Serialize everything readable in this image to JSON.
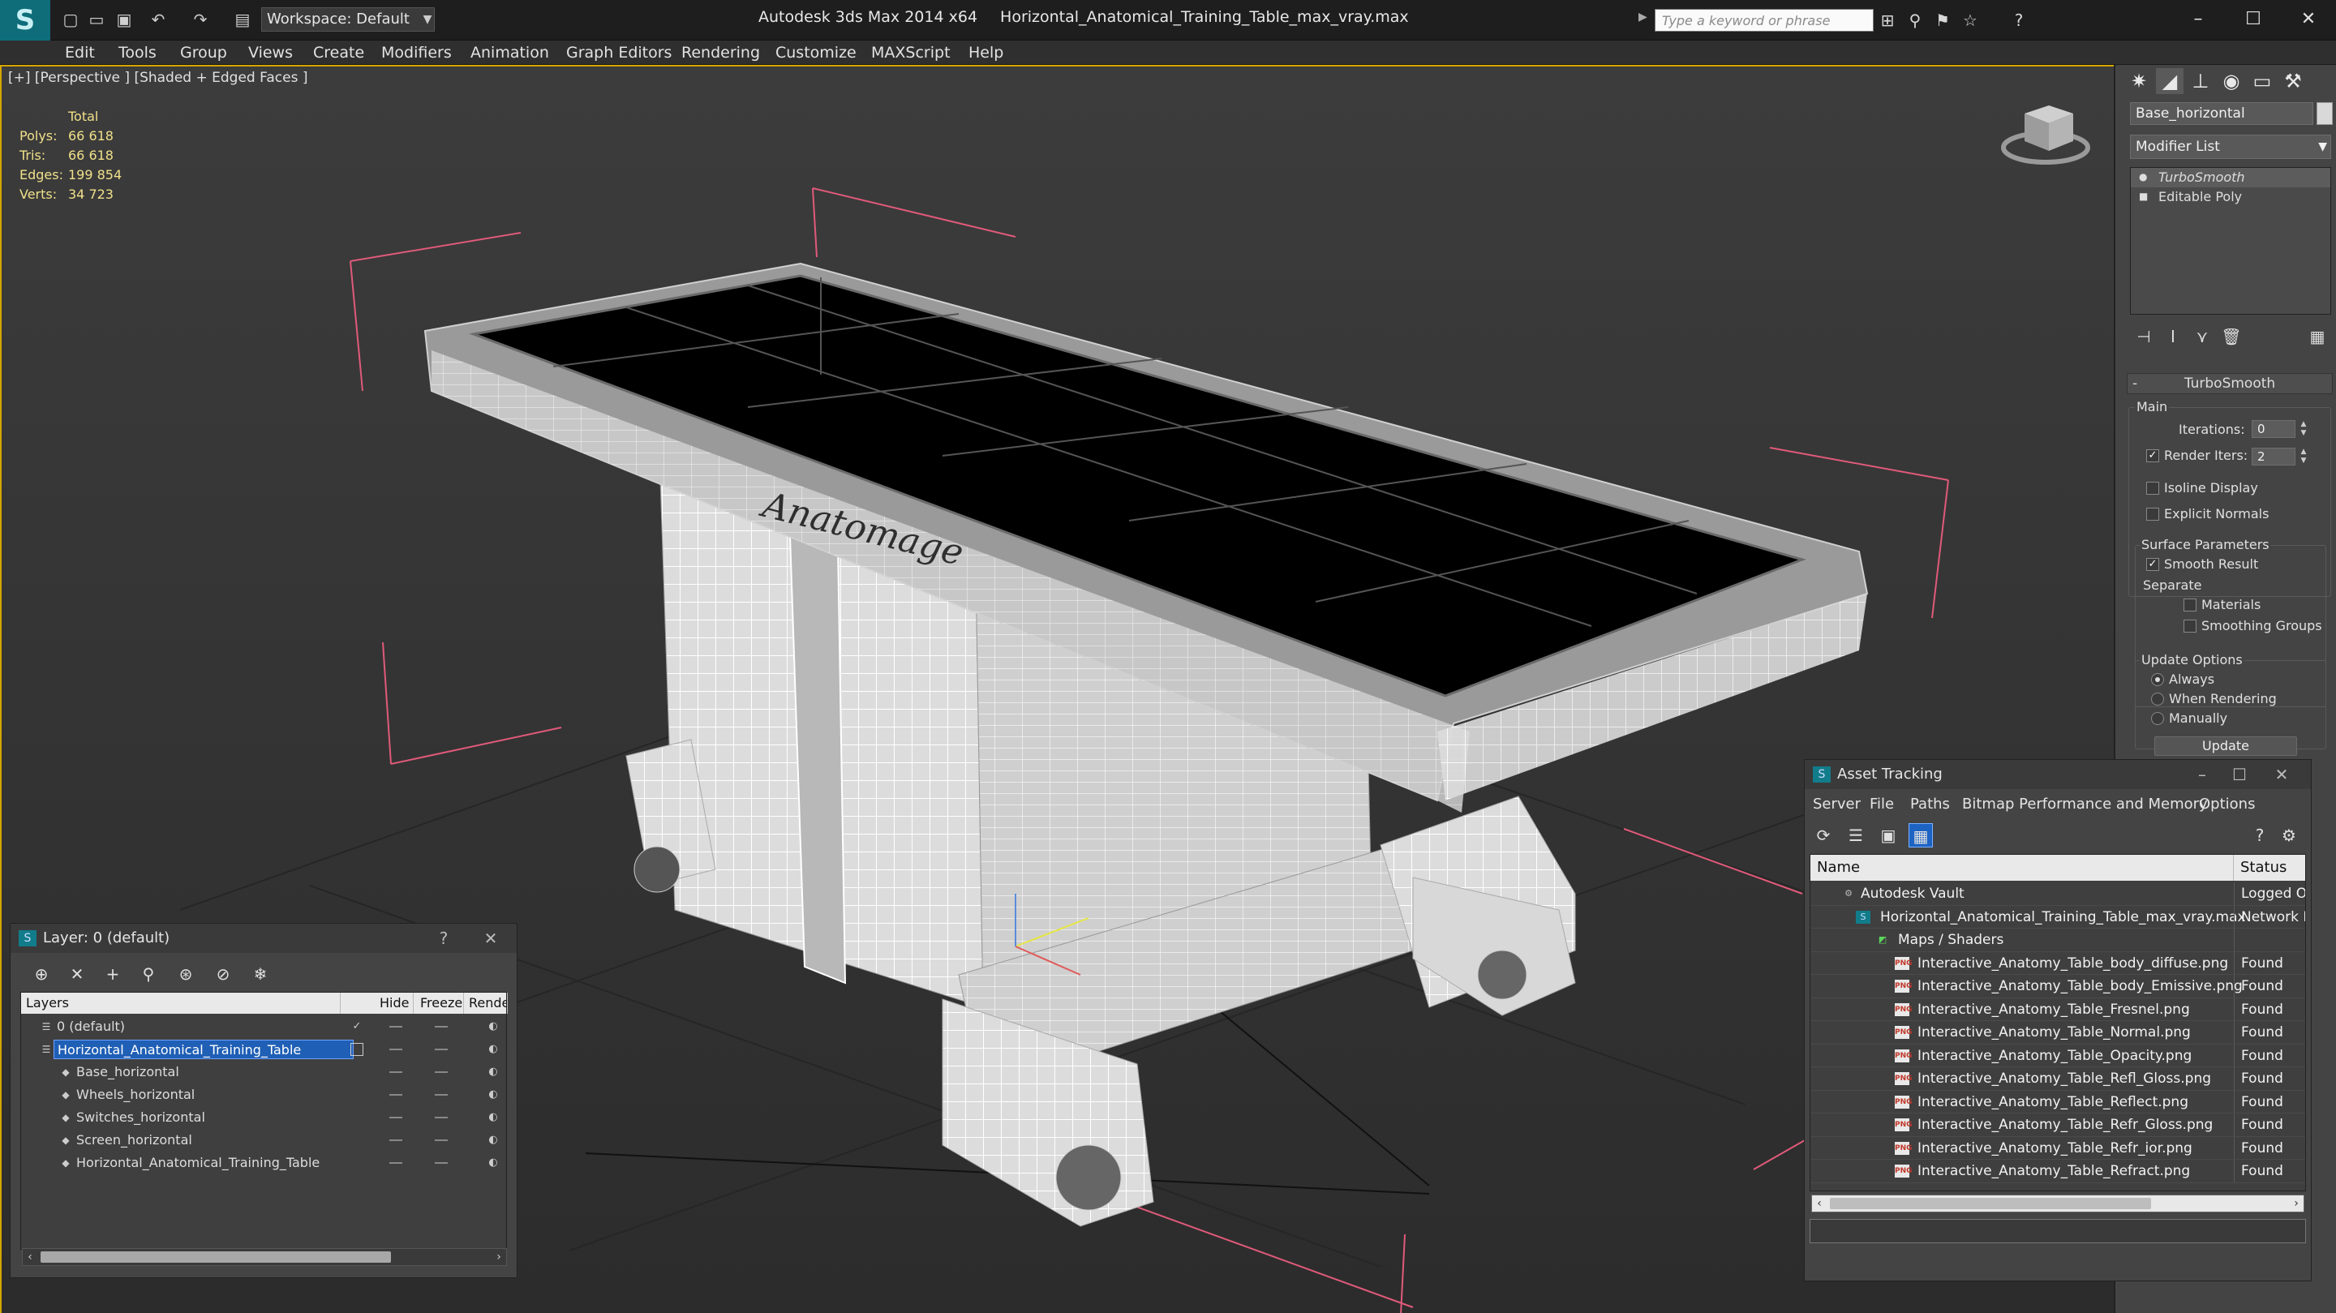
{
  "window": {
    "app_title": "Autodesk 3ds Max  2014 x64",
    "file_title": "Horizontal_Anatomical_Training_Table_max_vray.max",
    "workspace_label": "Workspace: Default",
    "search_placeholder": "Type a keyword or phrase"
  },
  "menu": [
    "Edit",
    "Tools",
    "Group",
    "Views",
    "Create",
    "Modifiers",
    "Animation",
    "Graph Editors",
    "Rendering",
    "Customize",
    "MAXScript",
    "Help"
  ],
  "viewport": {
    "label": "[+] [Perspective ] [Shaded + Edged Faces ]",
    "stats_header": "Total",
    "stats": [
      {
        "label": "Polys:",
        "value": "66 618"
      },
      {
        "label": "Tris:",
        "value": "66 618"
      },
      {
        "label": "Edges:",
        "value": "199 854"
      },
      {
        "label": "Verts:",
        "value": "34 723"
      }
    ],
    "model_brand_text": "Anatomage"
  },
  "command_panel": {
    "object_name": "Base_horizontal",
    "modifier_list_label": "Modifier List",
    "stack": [
      {
        "label": "TurboSmooth",
        "selected": true
      },
      {
        "label": "Editable Poly",
        "selected": false
      }
    ],
    "rollout_title": "TurboSmooth",
    "main_group": "Main",
    "iterations_label": "Iterations:",
    "iterations_value": "0",
    "render_iters_label": "Render Iters:",
    "render_iters_value": "2",
    "render_iters_checked": true,
    "isoline_label": "Isoline Display",
    "explicit_normals_label": "Explicit Normals",
    "surface_group": "Surface Parameters",
    "smooth_result_label": "Smooth Result",
    "separate_label": "Separate",
    "materials_label": "Materials",
    "smoothing_groups_label": "Smoothing Groups",
    "update_group": "Update Options",
    "always_label": "Always",
    "when_rendering_label": "When Rendering",
    "manually_label": "Manually",
    "update_button": "Update"
  },
  "layer_dialog": {
    "title": "Layer: 0 (default)",
    "help": "?",
    "columns": [
      "Layers",
      "Hide",
      "Freeze",
      "Rende"
    ],
    "rows": [
      {
        "name": "0 (default)",
        "level": 0
      },
      {
        "name": "Horizontal_Anatomical_Training_Table",
        "level": 0,
        "selected": true
      },
      {
        "name": "Base_horizontal",
        "level": 1
      },
      {
        "name": "Wheels_horizontal",
        "level": 1
      },
      {
        "name": "Switches_horizontal",
        "level": 1
      },
      {
        "name": "Screen_horizontal",
        "level": 1
      },
      {
        "name": "Horizontal_Anatomical_Training_Table",
        "level": 1
      }
    ]
  },
  "asset_dialog": {
    "title": "Asset Tracking",
    "menu": [
      "Server",
      "File",
      "Paths",
      "Bitmap Performance and Memory",
      "Options"
    ],
    "columns": [
      "Name",
      "Status"
    ],
    "rows": [
      {
        "name": "Autodesk Vault",
        "status": "Logged Ou",
        "level": 0,
        "icon": "vault"
      },
      {
        "name": "Horizontal_Anatomical_Training_Table_max_vray.max",
        "status": "Network P",
        "level": 1,
        "icon": "max"
      },
      {
        "name": "Maps / Shaders",
        "status": "",
        "level": 2,
        "icon": "maps"
      },
      {
        "name": "Interactive_Anatomy_Table_body_diffuse.png",
        "status": "Found",
        "level": 3,
        "icon": "png"
      },
      {
        "name": "Interactive_Anatomy_Table_body_Emissive.png",
        "status": "Found",
        "level": 3,
        "icon": "png"
      },
      {
        "name": "Interactive_Anatomy_Table_Fresnel.png",
        "status": "Found",
        "level": 3,
        "icon": "png"
      },
      {
        "name": "Interactive_Anatomy_Table_Normal.png",
        "status": "Found",
        "level": 3,
        "icon": "png"
      },
      {
        "name": "Interactive_Anatomy_Table_Opacity.png",
        "status": "Found",
        "level": 3,
        "icon": "png"
      },
      {
        "name": "Interactive_Anatomy_Table_Refl_Gloss.png",
        "status": "Found",
        "level": 3,
        "icon": "png"
      },
      {
        "name": "Interactive_Anatomy_Table_Reflect.png",
        "status": "Found",
        "level": 3,
        "icon": "png"
      },
      {
        "name": "Interactive_Anatomy_Table_Refr_Gloss.png",
        "status": "Found",
        "level": 3,
        "icon": "png"
      },
      {
        "name": "Interactive_Anatomy_Table_Refr_ior.png",
        "status": "Found",
        "level": 3,
        "icon": "png"
      },
      {
        "name": "Interactive_Anatomy_Table_Refract.png",
        "status": "Found",
        "level": 3,
        "icon": "png"
      }
    ]
  },
  "colors": {
    "selection_blue": "#1f5fb5",
    "stats_yellow": "#f0e08a",
    "viewport_border": "#d5a500",
    "logo_teal": "#0f6d7a"
  }
}
